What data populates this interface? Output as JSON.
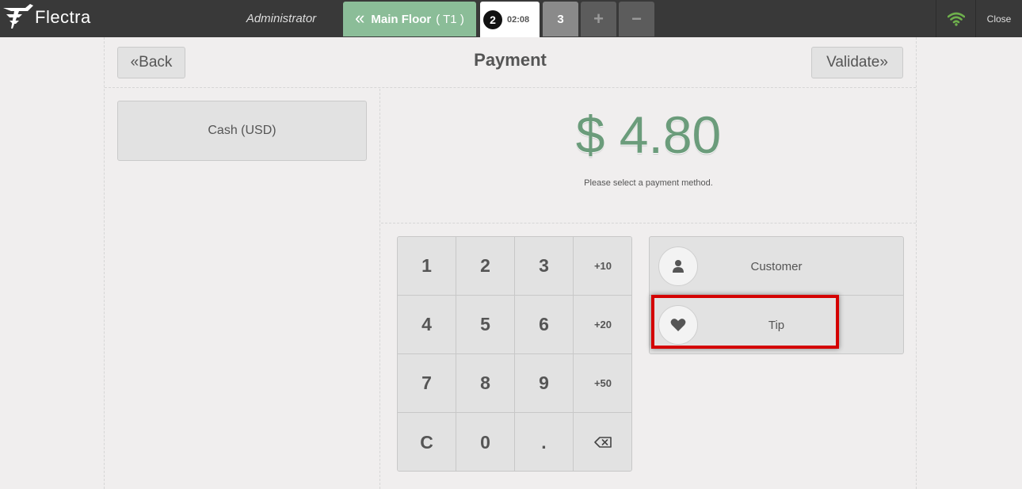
{
  "topbar": {
    "logo_text": "Flectra",
    "user": "Administrator",
    "floor_button": {
      "label": "Main Floor",
      "table": "( T1 )"
    },
    "orders": [
      {
        "number": "2",
        "time": "02:08",
        "selected": true
      },
      {
        "number": "3",
        "selected": false
      }
    ],
    "add_order_symbol": "+",
    "remove_order_symbol": "−",
    "close_label": "Close"
  },
  "payment": {
    "title": "Payment",
    "back_label": "Back",
    "validate_label": "Validate",
    "methods": [
      "Cash (USD)"
    ],
    "amount": "$ 4.80",
    "hint": "Please select a payment method."
  },
  "numpad": {
    "keys": [
      "1",
      "2",
      "3",
      "+10",
      "4",
      "5",
      "6",
      "+20",
      "7",
      "8",
      "9",
      "+50",
      "C",
      "0",
      ".",
      ""
    ]
  },
  "side_buttons": {
    "customer_label": "Customer",
    "tip_label": "Tip"
  },
  "colors": {
    "topbar": "#393939",
    "floor_button": "#8bbd98",
    "amount": "#6b9c7b",
    "highlight": "#d40000",
    "wifi": "#6eb04c"
  }
}
